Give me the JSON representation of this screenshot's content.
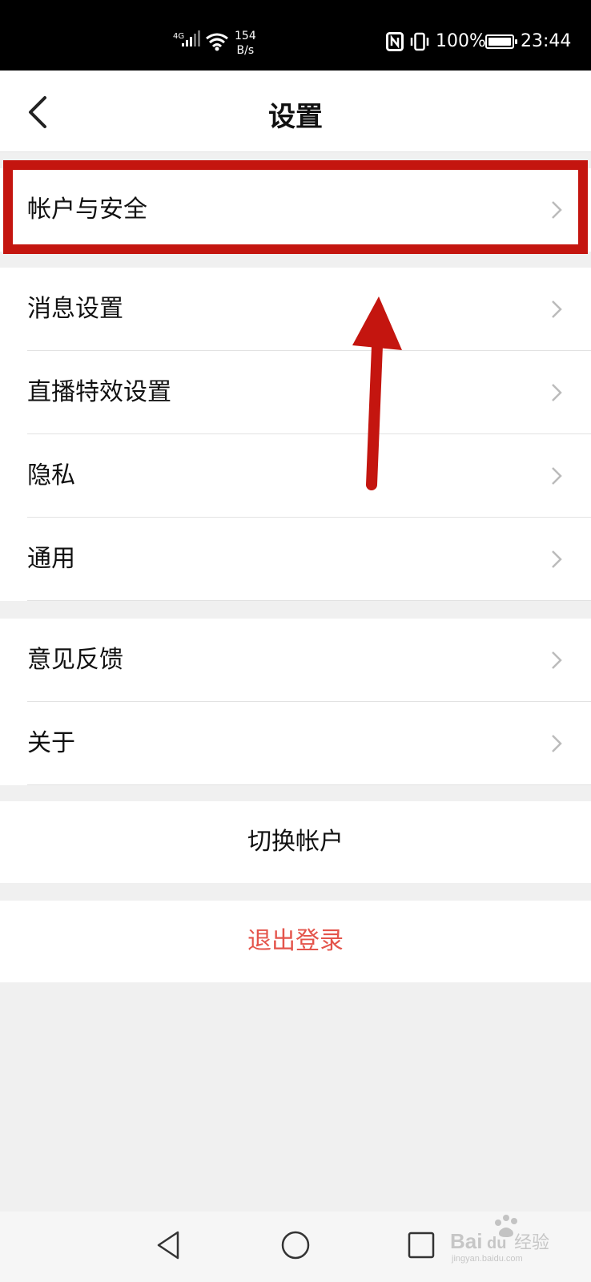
{
  "status_bar": {
    "network": "4G",
    "speed_value": "154",
    "speed_unit": "B/s",
    "battery": "100%",
    "battery_level": 1.0,
    "time": "23:44"
  },
  "header": {
    "title": "设置",
    "back_icon": "chevron-left-icon"
  },
  "groups": [
    {
      "items": [
        {
          "label": "帐户与安全"
        }
      ]
    },
    {
      "items": [
        {
          "label": "消息设置"
        },
        {
          "label": "直播特效设置"
        },
        {
          "label": "隐私"
        },
        {
          "label": "通用"
        }
      ]
    },
    {
      "items": [
        {
          "label": "意见反馈"
        },
        {
          "label": "关于"
        }
      ]
    }
  ],
  "actions": {
    "switch_account": "切换帐户",
    "logout": "退出登录"
  },
  "watermark": {
    "logo_text": "Baidu 经验",
    "url": "jingyan.baidu.com"
  },
  "colors": {
    "highlight": "#c4150f",
    "logout": "#e4544b",
    "background": "#f0f0f0"
  }
}
